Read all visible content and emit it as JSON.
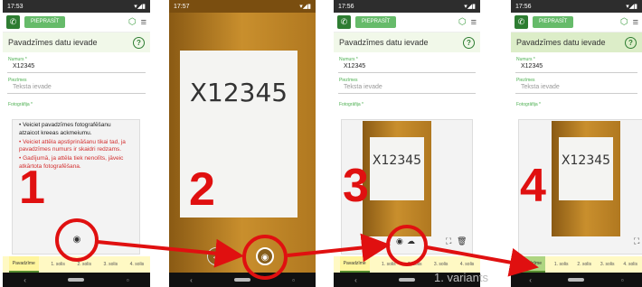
{
  "status_times": [
    "17:53",
    "17:57",
    "17:56",
    "17:56"
  ],
  "status_icons": "▾◢▮",
  "toolbar": {
    "call_icon": "✆",
    "pieprasit_label": "PIEPRASĪT",
    "menu_icon": "≡",
    "home_icon": "⬡"
  },
  "header": {
    "title": "Pavadzīmes datu ievade",
    "help": "?"
  },
  "fields": {
    "numurs_label": "Numurs *",
    "numurs_value": "X12345",
    "piezimes_label": "Piezīmes",
    "piezimes_placeholder": "Teksta ievade",
    "fotografija_label": "Fotogrāfija *"
  },
  "instructions": {
    "line1": "Veiciet pavadzīmes fotografēšanu atzaicot kreeas ackmeiumu.",
    "line2": "Veiciet attēla apstiprināšanu tikai tad, ja pavadzīmes numurs ir skaidri redzams.",
    "line3": "Gadījumā, ja attēla tiek nenolīts, jāveic atkārtota fotografēšana."
  },
  "tabs": [
    "Pavadzīme",
    "1. solis",
    "2. solis",
    "3. solis",
    "4. solis"
  ],
  "steps": [
    "1",
    "2",
    "3",
    "4"
  ],
  "photo_text": "X12345",
  "caption": "1. variants",
  "icons": {
    "camera": "◉",
    "upload": "☁",
    "crop": "⛶",
    "delete": "🗑",
    "back": "←",
    "back_nav": "‹",
    "square_nav": "▫"
  },
  "colors": {
    "accent": "#2e7d32",
    "arrow": "#e01010"
  }
}
